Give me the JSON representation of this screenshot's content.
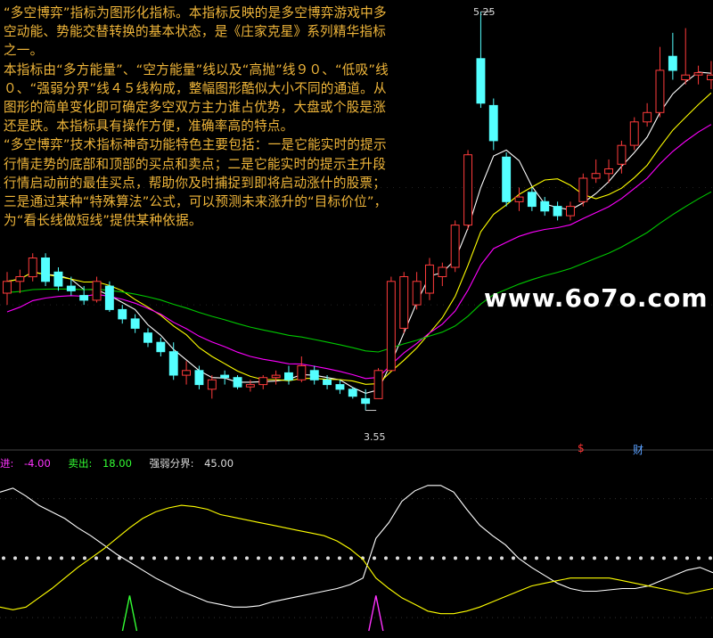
{
  "description": {
    "paragraphs": [
      "“多空博弈”指标为图形化指标。本指标反映的是多空博弈游戏中多空动能、势能交替转换的基本状态，是《庄家克星》系列精华指标之一。",
      "本指标由“多方能量”、“空方能量”线以及“高抛”线９０、“低吸”线０、“强弱分界”线４５线构成，整幅图形酷似大小不同的通道。从图形的简单变化即可确定多空双方主力谁占优势，大盘或个股是涨还是跌。本指标具有操作方便，准确率高的特点。",
      "“多空博弈”技术指标神奇功能特色主要包括：一是它能实时的提示行情走势的底部和顶部的买点和卖点；二是它能实时的提示主升段行情启动前的最佳买点，帮助你及时捕捉到即将启动涨什的股票；三是通过某种“特殊算法”公式，可以预测未来涨升的“目标价位”，为“看长线做短线”提供某种依据。"
    ]
  },
  "watermark": "www.6o7o.com",
  "price_labels": {
    "high": "5.25",
    "low": "3.55"
  },
  "markers": {
    "s": "$",
    "cai": "财"
  },
  "indicator_legend": {
    "buy_label": "进:",
    "buy_value": "-4.00",
    "sell_label": "卖出:",
    "sell_value": "18.00",
    "divide_label": "强弱分界:",
    "divide_value": "45.00"
  },
  "colors": {
    "background": "#000000",
    "up_candle": "#ff3b3b",
    "down_candle": "#54ffff",
    "ma_fast": "#ffffff",
    "ma_mid": "#ffff00",
    "ma_slow": "#ff00ff",
    "ma_long": "#00c800",
    "text_orange": "#f0b63a"
  },
  "chart_data": [
    {
      "type": "candlestick",
      "title": "",
      "ylim": [
        3.4,
        5.3
      ],
      "annotations": [
        {
          "label": "5.25",
          "value": 5.25,
          "index": 37
        },
        {
          "label": "3.55",
          "value": 3.55,
          "index": 28
        }
      ],
      "candles": [
        {
          "o": 4.05,
          "h": 4.14,
          "l": 4.0,
          "c": 4.1
        },
        {
          "o": 4.1,
          "h": 4.15,
          "l": 4.05,
          "c": 4.12
        },
        {
          "o": 4.12,
          "h": 4.22,
          "l": 4.1,
          "c": 4.2
        },
        {
          "o": 4.2,
          "h": 4.22,
          "l": 4.08,
          "c": 4.1
        },
        {
          "o": 4.14,
          "h": 4.16,
          "l": 4.06,
          "c": 4.08
        },
        {
          "o": 4.08,
          "h": 4.12,
          "l": 4.04,
          "c": 4.06
        },
        {
          "o": 4.04,
          "h": 4.08,
          "l": 4.0,
          "c": 4.02
        },
        {
          "o": 4.02,
          "h": 4.12,
          "l": 4.01,
          "c": 4.1
        },
        {
          "o": 4.08,
          "h": 4.1,
          "l": 3.97,
          "c": 3.98
        },
        {
          "o": 3.98,
          "h": 4.0,
          "l": 3.92,
          "c": 3.94
        },
        {
          "o": 3.94,
          "h": 3.96,
          "l": 3.88,
          "c": 3.9
        },
        {
          "o": 3.88,
          "h": 3.9,
          "l": 3.82,
          "c": 3.84
        },
        {
          "o": 3.84,
          "h": 3.86,
          "l": 3.78,
          "c": 3.8
        },
        {
          "o": 3.8,
          "h": 3.84,
          "l": 3.68,
          "c": 3.7
        },
        {
          "o": 3.7,
          "h": 3.76,
          "l": 3.66,
          "c": 3.72
        },
        {
          "o": 3.72,
          "h": 3.74,
          "l": 3.64,
          "c": 3.66
        },
        {
          "o": 3.64,
          "h": 3.7,
          "l": 3.6,
          "c": 3.68
        },
        {
          "o": 3.7,
          "h": 3.72,
          "l": 3.66,
          "c": 3.69
        },
        {
          "o": 3.69,
          "h": 3.7,
          "l": 3.64,
          "c": 3.65
        },
        {
          "o": 3.65,
          "h": 3.68,
          "l": 3.63,
          "c": 3.66
        },
        {
          "o": 3.66,
          "h": 3.7,
          "l": 3.64,
          "c": 3.69
        },
        {
          "o": 3.69,
          "h": 3.72,
          "l": 3.66,
          "c": 3.7
        },
        {
          "o": 3.71,
          "h": 3.74,
          "l": 3.66,
          "c": 3.68
        },
        {
          "o": 3.68,
          "h": 3.78,
          "l": 3.67,
          "c": 3.74
        },
        {
          "o": 3.72,
          "h": 3.74,
          "l": 3.66,
          "c": 3.68
        },
        {
          "o": 3.68,
          "h": 3.7,
          "l": 3.64,
          "c": 3.66
        },
        {
          "o": 3.66,
          "h": 3.68,
          "l": 3.62,
          "c": 3.64
        },
        {
          "o": 3.64,
          "h": 3.65,
          "l": 3.6,
          "c": 3.61
        },
        {
          "o": 3.6,
          "h": 3.64,
          "l": 3.55,
          "c": 3.58
        },
        {
          "o": 3.6,
          "h": 3.73,
          "l": 3.6,
          "c": 3.72
        },
        {
          "o": 3.72,
          "h": 4.12,
          "l": 3.72,
          "c": 4.1
        },
        {
          "o": 3.9,
          "h": 4.14,
          "l": 3.88,
          "c": 4.12
        },
        {
          "o": 4.0,
          "h": 4.14,
          "l": 3.98,
          "c": 4.1
        },
        {
          "o": 4.05,
          "h": 4.2,
          "l": 4.02,
          "c": 4.17
        },
        {
          "o": 4.12,
          "h": 4.18,
          "l": 4.08,
          "c": 4.16
        },
        {
          "o": 4.16,
          "h": 4.36,
          "l": 4.14,
          "c": 4.34
        },
        {
          "o": 4.34,
          "h": 4.66,
          "l": 4.32,
          "c": 4.64
        },
        {
          "o": 5.05,
          "h": 5.25,
          "l": 4.84,
          "c": 4.86
        },
        {
          "o": 4.85,
          "h": 4.88,
          "l": 4.66,
          "c": 4.7
        },
        {
          "o": 4.63,
          "h": 4.65,
          "l": 4.42,
          "c": 4.44
        },
        {
          "o": 4.44,
          "h": 4.5,
          "l": 4.4,
          "c": 4.46
        },
        {
          "o": 4.48,
          "h": 4.5,
          "l": 4.4,
          "c": 4.42
        },
        {
          "o": 4.44,
          "h": 4.46,
          "l": 4.38,
          "c": 4.4
        },
        {
          "o": 4.42,
          "h": 4.44,
          "l": 4.36,
          "c": 4.38
        },
        {
          "o": 4.38,
          "h": 4.44,
          "l": 4.36,
          "c": 4.42
        },
        {
          "o": 4.44,
          "h": 4.56,
          "l": 4.42,
          "c": 4.54
        },
        {
          "o": 4.54,
          "h": 4.62,
          "l": 4.52,
          "c": 4.56
        },
        {
          "o": 4.56,
          "h": 4.62,
          "l": 4.52,
          "c": 4.58
        },
        {
          "o": 4.6,
          "h": 4.7,
          "l": 4.56,
          "c": 4.68
        },
        {
          "o": 4.68,
          "h": 4.8,
          "l": 4.66,
          "c": 4.78
        },
        {
          "o": 4.78,
          "h": 4.86,
          "l": 4.76,
          "c": 4.82
        },
        {
          "o": 4.82,
          "h": 5.1,
          "l": 4.8,
          "c": 5.0
        },
        {
          "o": 5.06,
          "h": 5.16,
          "l": 4.96,
          "c": 5.0
        },
        {
          "o": 4.96,
          "h": 5.18,
          "l": 4.94,
          "c": 4.98
        },
        {
          "o": 4.98,
          "h": 5.02,
          "l": 4.94,
          "c": 4.99
        },
        {
          "o": 4.96,
          "h": 5.04,
          "l": 4.92,
          "c": 4.98
        }
      ],
      "ma_lines": [
        "ma_fast",
        "ma_mid",
        "ma_slow",
        "ma_long"
      ]
    },
    {
      "type": "line",
      "title": "",
      "ylim": [
        -10,
        110
      ],
      "reference_levels": [
        45
      ],
      "series": [
        {
          "color": "ma_fast",
          "values": [
            95,
            98,
            92,
            85,
            80,
            75,
            68,
            62,
            55,
            48,
            42,
            36,
            30,
            25,
            20,
            16,
            12,
            10,
            8,
            8,
            9,
            12,
            14,
            16,
            18,
            20,
            22,
            25,
            30,
            60,
            72,
            88,
            96,
            100,
            100,
            95,
            82,
            70,
            62,
            55,
            45,
            38,
            32,
            26,
            22,
            20,
            20,
            21,
            22,
            22,
            24,
            28,
            32,
            36,
            38,
            34
          ]
        },
        {
          "color": "ma_mid",
          "values": [
            8,
            6,
            8,
            15,
            22,
            30,
            38,
            45,
            52,
            60,
            68,
            75,
            80,
            83,
            85,
            84,
            82,
            78,
            76,
            74,
            72,
            70,
            68,
            66,
            64,
            62,
            58,
            52,
            44,
            30,
            22,
            15,
            10,
            5,
            3,
            3,
            5,
            8,
            12,
            16,
            20,
            24,
            26,
            28,
            30,
            30,
            30,
            30,
            28,
            26,
            24,
            22,
            20,
            18,
            20,
            22
          ]
        }
      ],
      "signals": [
        {
          "index": 10,
          "type": "sell",
          "color": "#33ff33",
          "height": 18
        },
        {
          "index": 29,
          "type": "buy",
          "color": "#ff33ff",
          "height": 18
        }
      ]
    }
  ]
}
